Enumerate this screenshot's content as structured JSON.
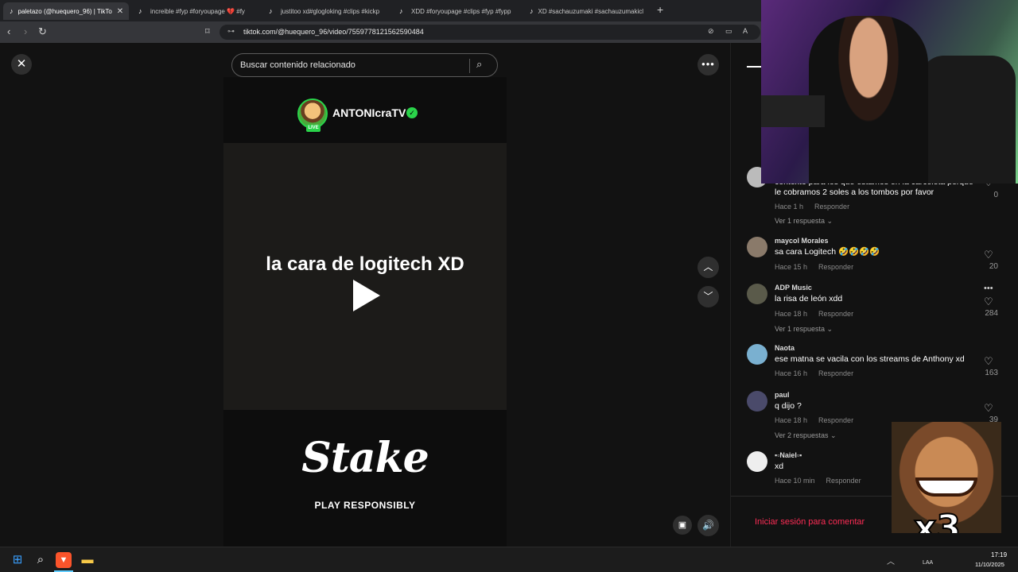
{
  "browser": {
    "tabs": [
      {
        "label": "paletazo (@huequero_96) | TikTo",
        "active": true
      },
      {
        "label": "increible #fyp #foryoupage 💔 #fy",
        "active": false
      },
      {
        "label": "justitoo xd#glogloking #clips #kickp",
        "active": false
      },
      {
        "label": "XDD #foryoupage #clips #fyp #fypp",
        "active": false
      },
      {
        "label": "XD #sachauzumaki #sachauzumakicl",
        "active": false
      }
    ],
    "url": "tiktok.com/@huequero_96/video/7559778121562590484"
  },
  "search": {
    "placeholder": "Buscar contenido relacionado"
  },
  "video": {
    "streamer_name": "ANTONIcraTV",
    "live_badge": "LIVE",
    "caption": "la cara de logitech XD",
    "sponsor_logo": "Stake",
    "sponsor_tagline": "PLAY RESPONSIBLY"
  },
  "comments": [
    {
      "user": "",
      "text": "contexto para los que estamos en la carceleta porque le cobramos 2 soles a los tombos por favor",
      "time": "Hace 1 h",
      "reply": "Responder",
      "likes": "0",
      "replies": "Ver 1 respuesta"
    },
    {
      "user": "maycol Morales",
      "text": "sa cara Logitech 🤣🤣🤣🤣",
      "time": "Hace 15 h",
      "reply": "Responder",
      "likes": "20",
      "replies": ""
    },
    {
      "user": "ADP Music",
      "text": "la risa de león xdd",
      "time": "Hace 18 h",
      "reply": "Responder",
      "likes": "284",
      "replies": "Ver 1 respuesta"
    },
    {
      "user": "Naota",
      "text": "ese matna se vacila con los streams de Anthony xd",
      "time": "Hace 16 h",
      "reply": "Responder",
      "likes": "163",
      "replies": ""
    },
    {
      "user": "paul",
      "text": "q dijo ?",
      "time": "Hace 18 h",
      "reply": "Responder",
      "likes": "39",
      "replies": "Ver 2 respuestas"
    },
    {
      "user": "▪▫Naiel▫▪",
      "text": "xd",
      "time": "Hace 10 min",
      "reply": "Responder",
      "likes": "",
      "replies": ""
    }
  ],
  "login_prompt": "Iniciar sesión para comentar",
  "overlay": {
    "meme_text": "x3"
  },
  "taskbar": {
    "lang": "LAA",
    "time": "17:19",
    "date": "11/10/2025"
  },
  "colors": {
    "accent": "#fe2c55",
    "verified": "#2ad34a"
  }
}
